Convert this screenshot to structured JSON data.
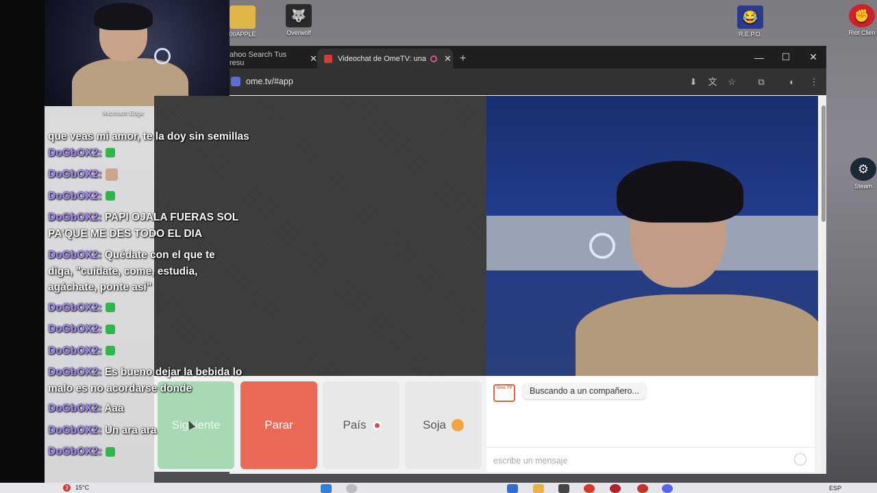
{
  "desktop": {
    "icons": [
      {
        "label": "00APPLE"
      },
      {
        "label": "Overwolf"
      },
      {
        "label": "R.E.P.O."
      },
      {
        "label": "Riot Clien"
      },
      {
        "label": "Steam"
      }
    ]
  },
  "overlay": {
    "webcam_label": "Microsoft Edge",
    "chat": [
      {
        "user": "",
        "text": "que veas mi amor, te la doy sin semillas"
      },
      {
        "user": "DoGbOX2:",
        "text": ""
      },
      {
        "user": "DoGbOX2:",
        "text": ""
      },
      {
        "user": "DoGbOX2:",
        "text": ""
      },
      {
        "user": "DoGbOX2:",
        "text": "PAPI OJALA FUERAS SOL PA'QUE ME DES TODO EL DIA"
      },
      {
        "user": "DoGbOX2:",
        "text": "Quédate con el que te diga, \"cuídate, come, estudia, agáchate, ponte así\""
      },
      {
        "user": "DoGbOX2:",
        "text": ""
      },
      {
        "user": "DoGbOX2:",
        "text": ""
      },
      {
        "user": "DoGbOX2:",
        "text": ""
      },
      {
        "user": "DoGbOX2:",
        "text": "Es bueno dejar la bebida lo malo es no acordarse donde"
      },
      {
        "user": "DoGbOX2:",
        "text": "Aaa"
      },
      {
        "user": "DoGbOX2:",
        "text": "Un ara ara"
      },
      {
        "user": "DoGbOX2:",
        "text": ""
      }
    ]
  },
  "browser": {
    "tabs": [
      {
        "label": "ahoo Search Tus resu",
        "active": false
      },
      {
        "label": "Videochat de OmeTV: una",
        "active": true
      }
    ],
    "new_tab": "+",
    "url": "ome.tv/#app",
    "window_controls": {
      "minimize": "—",
      "maximize": "☐",
      "close": "✕"
    }
  },
  "ometv": {
    "buttons": {
      "next": "Siguiente",
      "stop": "Parar",
      "country": "País",
      "gender": "Soja"
    },
    "status_message": "Buscando a un compañero...",
    "logo_text": "Ome TV",
    "message_placeholder": "escribe un mensaje"
  },
  "taskbar": {
    "weather": "15°C",
    "notification_count": "3",
    "language": "ESP"
  },
  "colors": {
    "next_button": "#a8d8b4",
    "stop_button": "#ea6a57",
    "username": "#a98bff",
    "browser_chrome": "#1f1f1f"
  }
}
